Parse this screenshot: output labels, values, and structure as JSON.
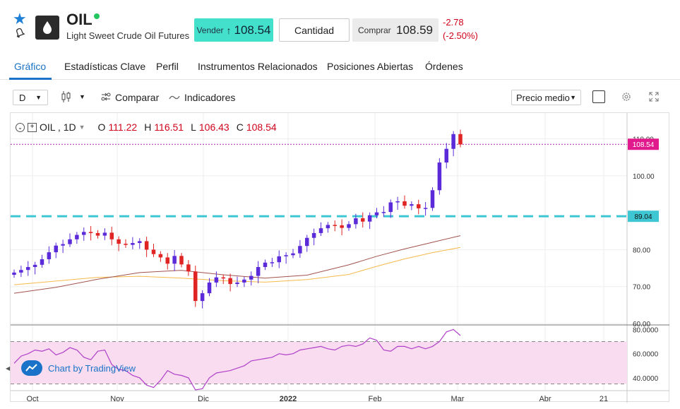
{
  "header": {
    "symbol": "OIL",
    "name": "Light Sweet Crude Oil Futures",
    "sell_label": "Vender",
    "sell_price": "108.54",
    "quantity_label": "Cantidad",
    "buy_label": "Comprar",
    "buy_price": "108.59",
    "change": "-2.78",
    "change_pct": "(-2.50%)",
    "sell_arrow_icon": "arrow-up-icon",
    "colors": {
      "sell_bg": "#43e0cb",
      "negative": "#d0021b",
      "live_dot": "#22c55e",
      "accent": "#1a73c8"
    }
  },
  "tabs": [
    "Gráfico",
    "Estadísticas Clave",
    "Perfil",
    "Instrumentos Relacionados",
    "Posiciones Abiertas",
    "Órdenes"
  ],
  "toolbar": {
    "interval": "D",
    "compare": "Comparar",
    "indicators": "Indicadores",
    "price_mode": "Precio medio"
  },
  "legend": {
    "symbol": "OIL , 1D",
    "o_label": "O",
    "o": "111.22",
    "h_label": "H",
    "h": "116.51",
    "l_label": "L",
    "l": "106.43",
    "c_label": "C",
    "c": "108.54"
  },
  "watermark": "Chart by TradingView",
  "chart_data": {
    "type": "candlestick",
    "x_labels": [
      "Oct",
      "Nov",
      "Dic",
      "2022",
      "Feb",
      "Mar",
      "Abr",
      "21"
    ],
    "price_ticks": [
      "110.00",
      "100.00",
      "80.00",
      "70.00",
      "60.00"
    ],
    "price_tags": {
      "last": "108.54",
      "line": "89.04"
    },
    "price_ylim": [
      60,
      117
    ],
    "rsi_ticks": [
      "80.0000",
      "60.0000",
      "40.0000"
    ],
    "rsi_ylim": [
      30,
      82
    ],
    "rsi_band": [
      35,
      70
    ],
    "closes": [
      73.8,
      74.5,
      75.3,
      75.9,
      77.4,
      79.3,
      81.1,
      81.5,
      82.8,
      84.0,
      84.8,
      84.5,
      83.8,
      84.6,
      82.8,
      81.6,
      81.3,
      81.8,
      82.3,
      80.0,
      78.8,
      77.9,
      76.2,
      78.3,
      76.0,
      74.1,
      66.1,
      68.2,
      71.1,
      72.5,
      72.3,
      70.7,
      71.1,
      71.9,
      72.9,
      75.3,
      76.5,
      76.6,
      78.2,
      78.5,
      79.0,
      81.0,
      83.2,
      84.5,
      85.8,
      86.7,
      86.6,
      85.9,
      86.9,
      88.5,
      87.6,
      89.3,
      90.1,
      90.2,
      92.8,
      93.1,
      91.9,
      92.3,
      91.2,
      91.3,
      96.1,
      103.6,
      107.3,
      111.3,
      108.5
    ],
    "ema_slow": [
      [
        0,
        70.5
      ],
      [
        6,
        71.5
      ],
      [
        12,
        72.5
      ],
      [
        18,
        72.8
      ],
      [
        24,
        72.3
      ],
      [
        30,
        71.6
      ],
      [
        36,
        71.2
      ],
      [
        42,
        71.9
      ],
      [
        48,
        73.3
      ],
      [
        52,
        75.5
      ],
      [
        56,
        77.5
      ],
      [
        60,
        79.2
      ],
      [
        64,
        80.6
      ]
    ],
    "ema_fast": [
      [
        0,
        68.2
      ],
      [
        6,
        69.8
      ],
      [
        12,
        72.0
      ],
      [
        18,
        73.8
      ],
      [
        24,
        74.4
      ],
      [
        30,
        73.2
      ],
      [
        36,
        72.3
      ],
      [
        42,
        73.1
      ],
      [
        48,
        75.9
      ],
      [
        52,
        78.2
      ],
      [
        56,
        80.2
      ],
      [
        60,
        82.0
      ],
      [
        64,
        83.8
      ]
    ],
    "rsi": [
      52,
      58,
      60,
      63,
      62,
      64,
      59,
      61,
      65,
      63,
      57,
      55,
      62,
      63,
      51,
      47,
      46,
      42,
      40,
      34,
      32,
      38,
      46,
      43,
      42,
      40,
      30,
      31,
      40,
      44,
      45,
      46,
      48,
      50,
      54,
      55,
      56,
      57,
      60,
      59,
      60,
      63,
      64,
      65,
      66,
      64,
      63,
      66,
      67,
      66,
      68,
      73,
      71,
      63,
      62,
      66,
      66,
      64,
      66,
      64,
      66,
      70,
      78,
      80,
      75
    ]
  }
}
